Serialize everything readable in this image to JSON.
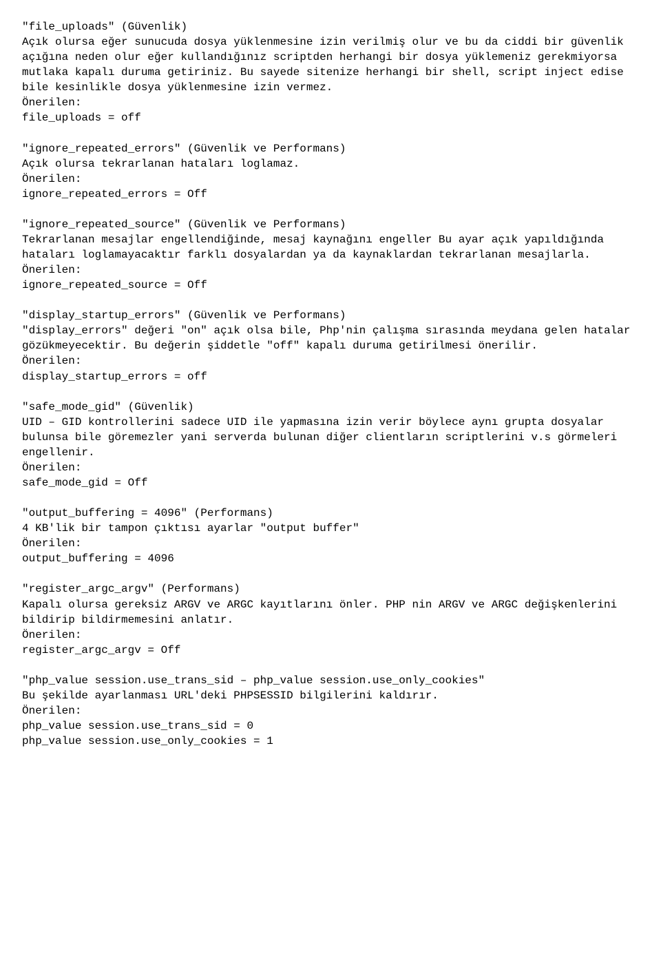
{
  "sections": [
    {
      "lines": [
        "\"file_uploads\" (Güvenlik)",
        "Açık olursa eğer sunucuda dosya yüklenmesine izin verilmiş olur ve bu da ciddi bir güvenlik açığına neden olur eğer kullandığınız scriptden herhangi bir dosya yüklemeniz gerekmiyorsa mutlaka kapalı duruma getiriniz. Bu sayede sitenize herhangi bir shell, script inject edise bile kesinlikle dosya yüklenmesine izin vermez.",
        "Önerilen:",
        "file_uploads = off"
      ]
    },
    {
      "lines": [
        "\"ignore_repeated_errors\" (Güvenlik ve Performans)",
        "Açık olursa tekrarlanan hataları loglamaz.",
        "Önerilen:",
        "ignore_repeated_errors = Off"
      ]
    },
    {
      "lines": [
        "\"ignore_repeated_source\" (Güvenlik ve Performans)",
        "Tekrarlanan mesajlar engellendiğinde, mesaj kaynağını engeller Bu ayar açık yapıldığında hataları loglamayacaktır farklı dosyalardan ya da kaynaklardan tekrarlanan mesajlarla.",
        "Önerilen:",
        "ignore_repeated_source = Off"
      ]
    },
    {
      "lines": [
        "\"display_startup_errors\" (Güvenlik ve Performans)",
        "\"display_errors\" değeri \"on\" açık olsa bile, Php'nin çalışma sırasında meydana gelen hatalar gözükmeyecektir. Bu değerin şiddetle \"off\" kapalı duruma getirilmesi önerilir.",
        "Önerilen:",
        "display_startup_errors = off"
      ]
    },
    {
      "lines": [
        "\"safe_mode_gid\" (Güvenlik)",
        "UID – GID kontrollerini sadece UID ile yapmasına izin verir böylece aynı grupta dosyalar bulunsa bile göremezler yani serverda bulunan diğer clientların scriptlerini v.s görmeleri engellenir.",
        "Önerilen:",
        "safe_mode_gid = Off"
      ]
    },
    {
      "lines": [
        "\"output_buffering = 4096″ (Performans)",
        "4 KB'lik bir tampon çıktısı ayarlar \"output buffer\"",
        "Önerilen:",
        "output_buffering = 4096"
      ]
    },
    {
      "lines": [
        "\"register_argc_argv\" (Performans)",
        "Kapalı olursa gereksiz ARGV ve ARGC kayıtlarını önler. PHP nin ARGV ve ARGC değişkenlerini bildirip bildirmemesini anlatır.",
        "Önerilen:",
        "register_argc_argv = Off"
      ]
    },
    {
      "lines": [
        "\"php_value session.use_trans_sid – php_value session.use_only_cookies\"",
        "Bu şekilde ayarlanması URL'deki PHPSESSID bilgilerini kaldırır.",
        "Önerilen:",
        "php_value session.use_trans_sid = 0",
        "php_value session.use_only_cookies = 1"
      ]
    }
  ]
}
